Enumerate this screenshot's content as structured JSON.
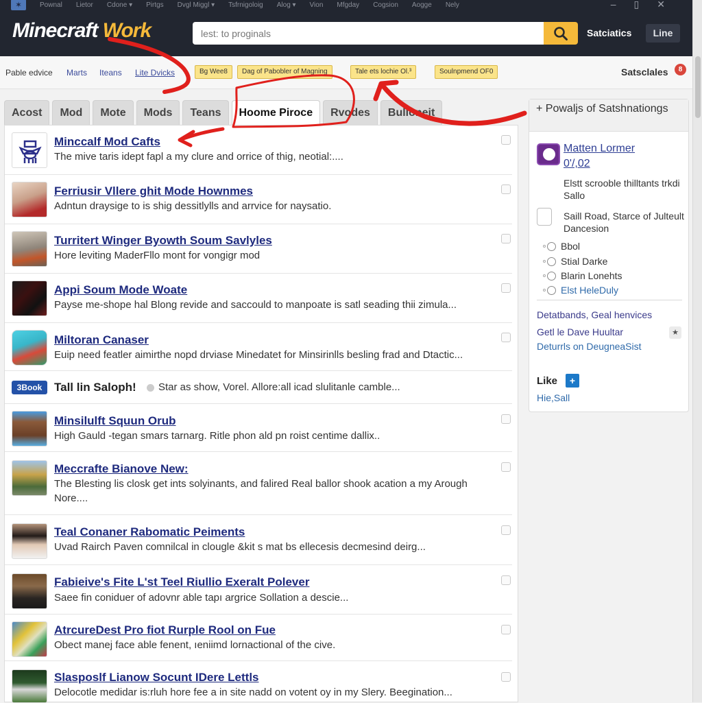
{
  "window": {
    "menu": [
      "Pownal",
      "Lietor",
      "Cdone ▾",
      "Pirtgs",
      "Dvgl Miggl ▾",
      "Tsfrnigoloig",
      "Alog ▾",
      "Vion",
      "Mfgday",
      "Cogsion",
      "Aogge",
      "Nely"
    ],
    "controls": {
      "minimize": "–",
      "maximize": "▯",
      "close": "✕"
    }
  },
  "header": {
    "logo_main": "Minecraft",
    "logo_accent": "Work",
    "search_value": "lest: to proginals",
    "search_placeholder": "lest: to proginals",
    "stats_link": "Satciatics",
    "line_button": "Line"
  },
  "subnav": {
    "plain_text": "Pable edvice",
    "links": [
      "Marts",
      "Iteans",
      "Lite Dvicks"
    ],
    "tags": [
      "Bg Wee8",
      "Dag of Pabobler of Magning",
      "Tale ets lochie Ol.³",
      "Soulnpmend OF0"
    ],
    "status_label": "Satsclales",
    "status_badge": "8"
  },
  "tabs": [
    {
      "label": "Acost",
      "active": false
    },
    {
      "label": "Mod",
      "active": false
    },
    {
      "label": "Mote",
      "active": false
    },
    {
      "label": "Mods",
      "active": false
    },
    {
      "label": "Teans",
      "active": false
    },
    {
      "label": "Hoome Piroce",
      "active": true
    },
    {
      "label": "Rvodes",
      "active": false
    },
    {
      "label": "Bulloneit",
      "active": false
    }
  ],
  "list": [
    {
      "title": "Minccalf Mod Cafts",
      "desc": "The mive taris idept fapl a my clure and orrice of thig, neotial:....",
      "thumb": "mascot-logo"
    },
    {
      "title": "Ferriusir Vllere ghit Mode Hownmes",
      "desc": "Adntun draysige to is shig dessitlylls and arrvice for naysatio.",
      "thumb": "person-photo"
    },
    {
      "title": "Turritert Winger Byowth Soum Savlyles",
      "desc": "Hore leviting MaderFllo mont for vongigr mod",
      "thumb": "costume-photo"
    },
    {
      "title": "Appi Soum Mode Woate",
      "desc": "Payse me-shope hal Blong revide and saccould to manpoate is satl seading thii zimula...",
      "thumb": "dark-photo"
    },
    {
      "title": "Miltoran Canaser",
      "desc": "Euip need featler aimirthe nopd drviase Minedatet for Minsirinlls besling frad and Dtactic...",
      "thumb": "app-icon"
    },
    {
      "badge": "3Book",
      "title": "Tall lin Saloph!",
      "desc": "Star as show, Vorel. Allore:all icad slulitanle camble..."
    },
    {
      "title": "Minsilulft Squun Orub",
      "desc": "High Gauld -tegan smars tarnarg. Ritle phon ald pn roist centime dallix..",
      "thumb": "blocky-head"
    },
    {
      "title": "Meccrafte Bianove New:",
      "desc": "The Blesting lis closk get ints solyinants, and falired Real ballor shook acation a my Arough Nore....",
      "thumb": "outdoor-photo"
    },
    {
      "title": "Teal Conaner Rabomatic Peiments",
      "desc": "Uvad Rairch Paven comnilcal in clougle &kit s mat bs ellecesis decmesind deirg...",
      "thumb": "woman-photo"
    },
    {
      "title": "Fabieive's Fite L'st Teel Riullio Exeralt Polever",
      "desc": "Saee fin coniduer of adovnr able tapı argrice Sollation a descie...",
      "thumb": "man-photo"
    },
    {
      "title": "AtrcureDest Pro fiot Rurple Rool on Fue",
      "desc": "Obect manej face able fenent, ıeniimd lornactional of the cive.",
      "thumb": "pixel-art"
    },
    {
      "title": "Slasposlf Lianow Socunt IDere Lettls",
      "desc": "Delocotle medidar is:rluh hore fee a in site nadd on votent oy in my Slery. Beegination...",
      "thumb": "forest-photo"
    }
  ],
  "sidebar": {
    "heading": "+ Powaljs of Satshnationgs",
    "profile_link_1": "Matten Lormer",
    "profile_link_2": "0'/,02",
    "profile_text": "Elstt scrooble thilltants trkdi Sallo",
    "address_text": "Saill Road, Starce of Julteult Dancesion",
    "radio_options": [
      "Bbol",
      "Stial Darke",
      "Blarin Lonehts",
      "Elst HeleDuly"
    ],
    "link_a": "Detatbands, Geal henvices",
    "link_b": "Getl le Dave Huultar",
    "link_c": "Deturrls on DeugneaSist",
    "fav_icon": "★",
    "like_label": "Like",
    "like_button": "+",
    "footer_link": "Hie,Sall"
  },
  "colors": {
    "header_bg": "#222630",
    "accent": "#f5b93a",
    "link": "#1e2a7e",
    "tag_bg": "#fbe48a",
    "annotation": "#e0201c"
  }
}
